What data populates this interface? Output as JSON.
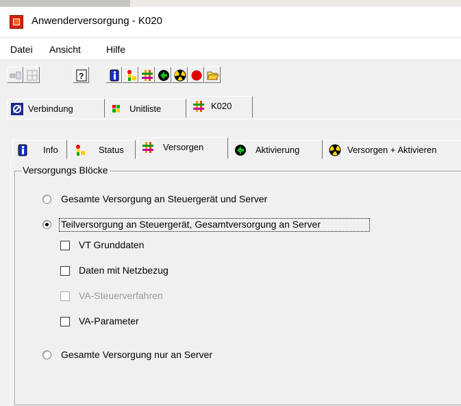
{
  "window": {
    "title": "Anwenderversorgung - K020"
  },
  "menu": {
    "items": [
      "Datei",
      "Ansicht",
      "Hilfe"
    ]
  },
  "toolbar": {
    "buttons": [
      {
        "icon": "connect-icon",
        "enabled": false
      },
      {
        "icon": "network-icon",
        "enabled": false
      },
      {
        "icon": "help-icon",
        "enabled": true
      },
      {
        "icon": "info-icon",
        "enabled": true
      },
      {
        "icon": "status-icon",
        "enabled": true
      },
      {
        "icon": "versorgen-icon",
        "enabled": true
      },
      {
        "icon": "activate-icon",
        "enabled": true
      },
      {
        "icon": "radiation-icon",
        "enabled": true
      },
      {
        "icon": "stop-icon",
        "enabled": true
      },
      {
        "icon": "folder-open-icon",
        "enabled": true
      }
    ]
  },
  "top_tabs": [
    {
      "label": "Verbindung",
      "icon": "satellite-icon",
      "active": false
    },
    {
      "label": "Unitliste",
      "icon": "unitlist-icon",
      "active": false
    },
    {
      "label": "K020",
      "icon": "versorgen-icon",
      "active": true
    }
  ],
  "sub_tabs": [
    {
      "label": "Info",
      "icon": "info-icon",
      "active": false
    },
    {
      "label": "Status",
      "icon": "status-icon",
      "active": false
    },
    {
      "label": "Versorgen",
      "icon": "versorgen-icon",
      "active": true
    },
    {
      "label": "Aktivierung",
      "icon": "activate-icon",
      "active": false
    },
    {
      "label": "Versorgen + Aktivieren",
      "icon": "radiation-icon",
      "active": false
    }
  ],
  "group": {
    "title": "Versorgungs Blöcke",
    "radios": [
      {
        "label": "Gesamte Versorgung an Steuergerät und Server",
        "selected": false
      },
      {
        "label": "Teilversorgung an Steuergerät, Gesamtversorgung an Server",
        "selected": true
      },
      {
        "label": "Gesamte Versorgung nur an Server",
        "selected": false
      }
    ],
    "checkboxes": [
      {
        "label": "VT Grunddaten",
        "checked": false,
        "enabled": true
      },
      {
        "label": "Daten mit Netzbezug",
        "checked": false,
        "enabled": true
      },
      {
        "label": "VA-Steuerverfahren",
        "checked": false,
        "enabled": false
      },
      {
        "label": "VA-Parameter",
        "checked": false,
        "enabled": true
      }
    ]
  },
  "colors": {
    "face": "#f0f0f0",
    "title_bg": "#ffffff",
    "disabled_text": "#9a9a9a"
  }
}
